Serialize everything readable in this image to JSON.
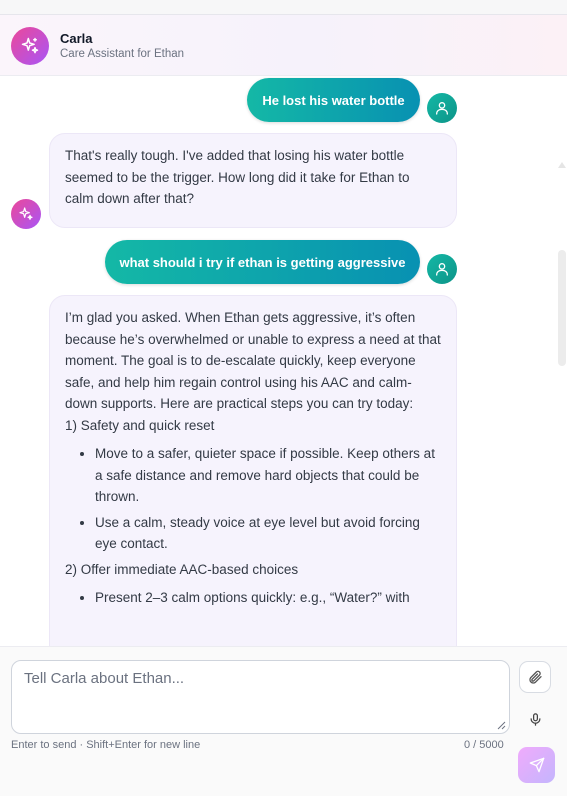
{
  "header": {
    "name": "Carla",
    "subtitle": "Care Assistant for Ethan",
    "avatar_icon": "sparkle-icon"
  },
  "messages": [
    {
      "role": "user",
      "text": "He lost his water bottle"
    },
    {
      "role": "assistant",
      "text": "That's really tough. I've added that losing his water bottle seemed to be the trigger. How long did it take for Ethan to calm down after that?"
    },
    {
      "role": "user",
      "text": "what should i try if ethan is getting aggressive"
    },
    {
      "role": "assistant",
      "intro": "I’m glad you asked. When Ethan gets aggressive, it’s often because he’s overwhelmed or unable to express a need at that moment. The goal is to de-escalate quickly, keep everyone safe, and help him regain control using his AAC and calm-down supports. Here are practical steps you can try today:",
      "section1_title": "1) Safety and quick reset",
      "section1_items": [
        "Move to a safer, quieter space if possible. Keep others at a safe distance and remove hard objects that could be thrown.",
        "Use a calm, steady voice at eye level but avoid forcing eye contact."
      ],
      "section2_title": "2) Offer immediate AAC-based choices",
      "section2_items": [
        "Present 2–3 calm options quickly: e.g., “Water?” with"
      ]
    }
  ],
  "composer": {
    "placeholder": "Tell Carla about Ethan...",
    "value": "",
    "hint": "Enter to send · Shift+Enter for new line",
    "counter": "0 / 5000"
  },
  "icons": {
    "attach": "paperclip-icon",
    "mic": "microphone-icon",
    "send": "send-icon",
    "user_avatar": "user-icon",
    "assistant_avatar": "sparkle-icon"
  },
  "colors": {
    "user_bubble_start": "#14b8a6",
    "user_bubble_end": "#0891b2",
    "assistant_bubble": "#f6f3fd",
    "brand_pink": "#ec4899",
    "brand_purple": "#a855f7"
  }
}
